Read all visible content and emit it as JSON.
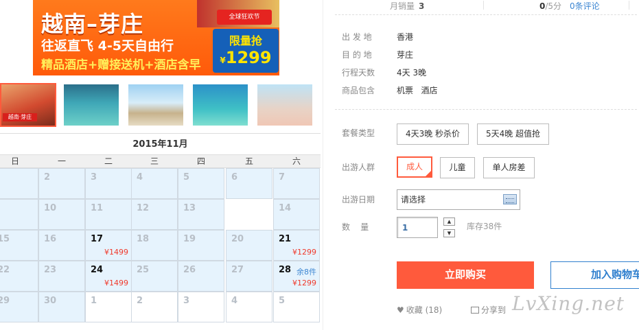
{
  "banner": {
    "title": "越南–芽庄",
    "line2": "往返直飞 4-5天自由行",
    "line3": "精品酒店+赠接送机+酒店含早",
    "badge": "全球狂欢节",
    "promo_label": "限量抢",
    "promo_price": "1299",
    "promo_currency": "¥"
  },
  "thumbnails": [
    "越南·芽庄",
    "",
    "",
    "",
    ""
  ],
  "calendar": {
    "title": "2015年11月",
    "weekdays": [
      "日",
      "一",
      "二",
      "三",
      "四",
      "五",
      "六"
    ],
    "rows": [
      [
        {
          "d": ""
        },
        {
          "d": "2"
        },
        {
          "d": "3"
        },
        {
          "d": "4"
        },
        {
          "d": "5"
        },
        {
          "d": "6"
        },
        {
          "d": "7"
        }
      ],
      [
        {
          "d": ""
        },
        {
          "d": "10"
        },
        {
          "d": "11"
        },
        {
          "d": "12"
        },
        {
          "d": "13"
        },
        {
          "d": "14"
        }
      ],
      [
        {
          "d": "15"
        },
        {
          "d": "16"
        },
        {
          "d": "17",
          "on": true,
          "price": "¥1499"
        },
        {
          "d": "18"
        },
        {
          "d": "19"
        },
        {
          "d": "20"
        },
        {
          "d": "21",
          "on": true,
          "price": "¥1299"
        }
      ],
      [
        {
          "d": "22"
        },
        {
          "d": "23"
        },
        {
          "d": "24",
          "on": true,
          "price": "¥1499"
        },
        {
          "d": "25"
        },
        {
          "d": "26"
        },
        {
          "d": "27"
        },
        {
          "d": "28",
          "on": true,
          "price": "¥1299",
          "remain": "余8件"
        }
      ],
      [
        {
          "d": "29"
        },
        {
          "d": "30"
        },
        {
          "d": "1",
          "next": true
        },
        {
          "d": "2",
          "next": true
        },
        {
          "d": "3",
          "next": true
        },
        {
          "d": "4",
          "next": true
        },
        {
          "d": "5",
          "next": true
        }
      ]
    ]
  },
  "stats": {
    "sales_label": "月销量",
    "sales_value": "3",
    "score_value": "0",
    "score_suffix": "/5分",
    "reviews": "0条评论"
  },
  "info": [
    {
      "key": "出 发 地",
      "value": "香港"
    },
    {
      "key": "目 的 地",
      "value": "芽庄"
    },
    {
      "key": "行程天数",
      "value": "4天 3晚"
    },
    {
      "key": "商品包含",
      "value": "机票   酒店"
    }
  ],
  "package": {
    "label": "套餐类型",
    "options": [
      "4天3晚 秒杀价",
      "5天4晚 超值抢"
    ]
  },
  "travelers": {
    "label": "出游人群",
    "options": [
      "成人",
      "儿童",
      "单人房差"
    ],
    "selected": "成人"
  },
  "date": {
    "label": "出游日期",
    "value": "请选择"
  },
  "quantity": {
    "label": "数    量",
    "value": "1",
    "stock": "库存38件"
  },
  "actions": {
    "buy": "立即购买",
    "cart": "加入购物车"
  },
  "footer": {
    "favorite": "收藏",
    "favorite_count": "(18)",
    "share": "分享到"
  },
  "watermark": "LvXing.net"
}
